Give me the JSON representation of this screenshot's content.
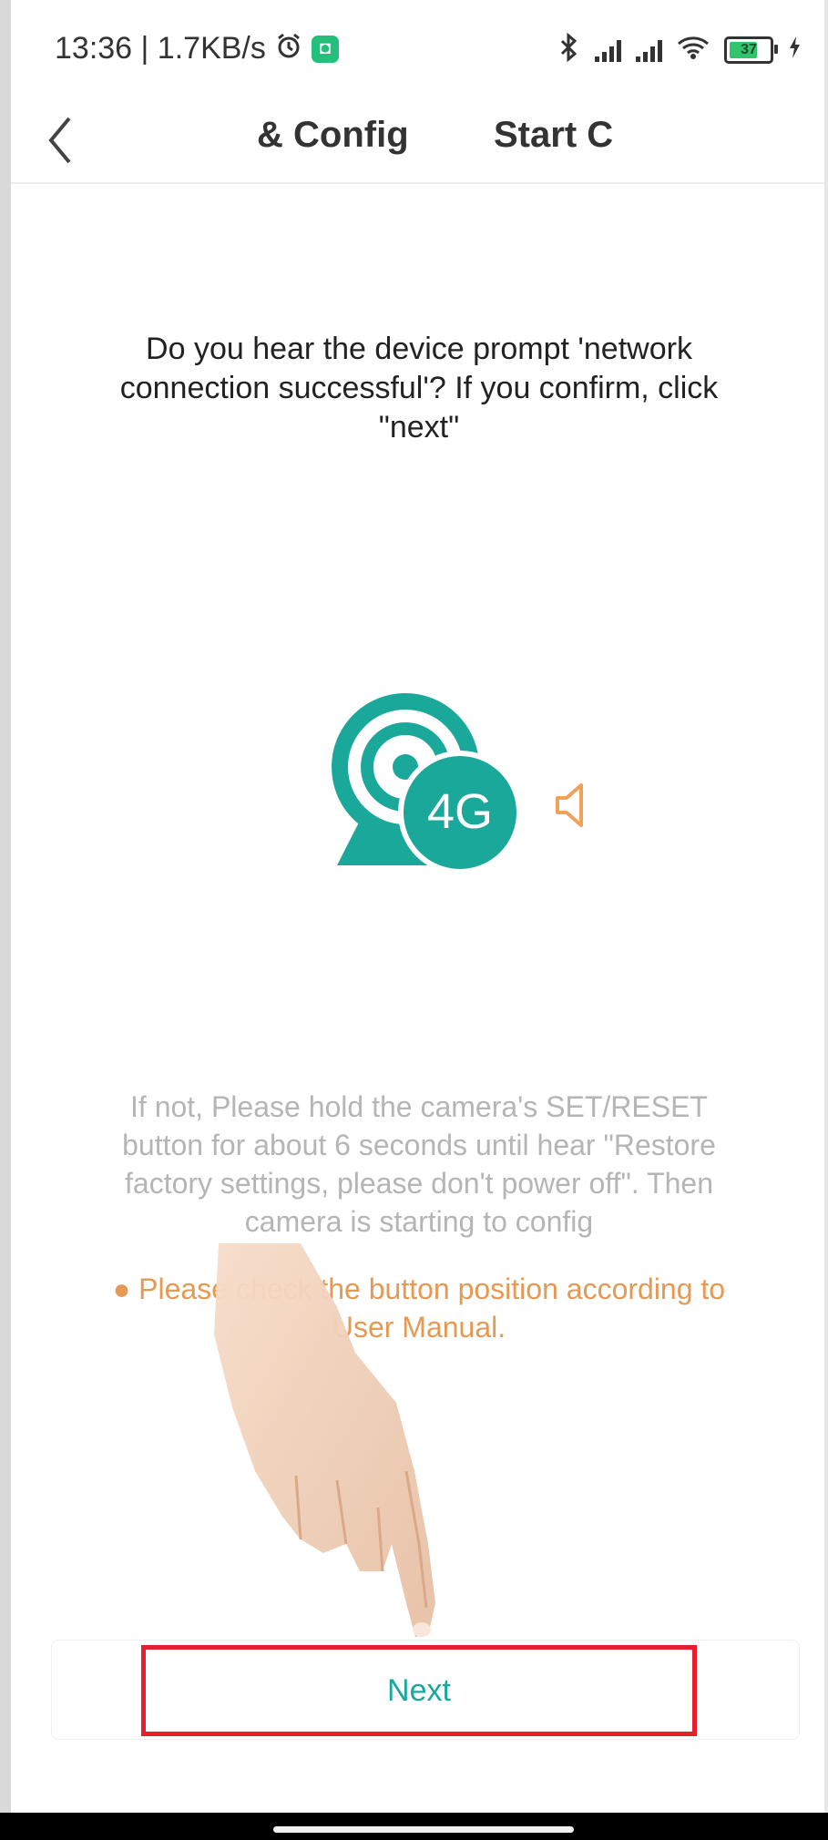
{
  "status_bar": {
    "time_speed": "13:36 | 1.7KB/s",
    "icons": [
      "alarm-icon",
      "app-badge-icon",
      "bluetooth-icon",
      "signal-icon",
      "signal-icon",
      "wifi-icon",
      "battery-icon",
      "charging-icon"
    ],
    "battery_level": "37"
  },
  "header": {
    "back_icon": "chevron-left-icon",
    "tabs": [
      {
        "label": "& Config"
      },
      {
        "label": "Start C"
      }
    ]
  },
  "main": {
    "prompt": "Do you hear the device prompt 'network connection successful'? If you confirm, click \"next\"",
    "device_badge": "4G",
    "help_text": "If not, Please hold the camera's SET/RESET button for about 6 seconds until hear \"Restore factory settings, please don't power off\". Then camera is starting to config",
    "note_text": "● Please check the button position according to User Manual."
  },
  "footer": {
    "next_label": "Next"
  },
  "colors": {
    "accent_teal": "#1aa89a",
    "note_orange": "#e49a55",
    "highlight_red": "#e5202a",
    "speaker_orange": "#f0a15a"
  }
}
